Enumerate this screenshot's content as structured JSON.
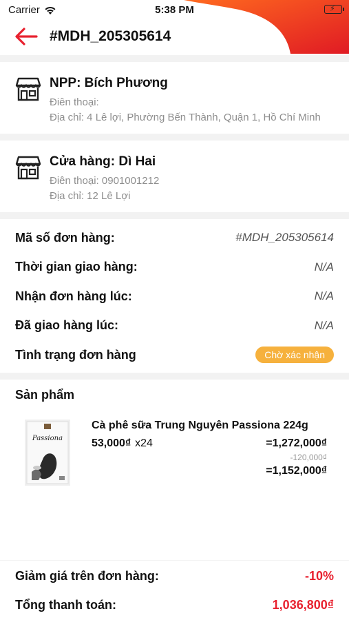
{
  "status_bar": {
    "carrier": "Carrier",
    "time": "5:38 PM"
  },
  "header": {
    "title": "#MDH_205305614"
  },
  "distributor": {
    "name": "NPP: Bích Phương",
    "phone": "Điên thoại:",
    "address": "Địa chỉ: 4 Lê lợi, Phường Bến Thành,  Quận 1, Hồ Chí Minh"
  },
  "store": {
    "name": "Cửa hàng: Dì Hai",
    "phone": "Điên thoại: 0901001212",
    "address": "Địa chỉ: 12 Lê Lợi"
  },
  "order": {
    "code_label": "Mã số đơn hàng:",
    "code_value": "#MDH_205305614",
    "delivery_time_label": "Thời gian giao hàng:",
    "delivery_time_value": "N/A",
    "received_label": "Nhận đơn hàng lúc:",
    "received_value": "N/A",
    "delivered_label": "Đã giao hàng lúc:",
    "delivered_value": "N/A",
    "status_label": "Tình trạng đơn hàng",
    "status_value": "Chờ xác nhận"
  },
  "products": {
    "title": "Sản phẩm",
    "items": [
      {
        "name": "Cà phê sữa Trung Nguyên Passiona 224g",
        "unit_price": "53,000₫",
        "quantity": "x24",
        "subtotal": "=1,272,000₫",
        "discount": "-120,000₫",
        "total": "=1,152,000₫",
        "image_text": "Passiona"
      }
    ]
  },
  "summary": {
    "discount_label": "Giảm giá trên đơn hàng:",
    "discount_value": "-10%",
    "total_label": "Tổng thanh toán:",
    "total_value": "1,036,800₫"
  },
  "colors": {
    "accent": "#e8212f",
    "badge": "#f6b13d",
    "header_gradient": [
      "#ff5a1f",
      "#e01b24"
    ]
  }
}
